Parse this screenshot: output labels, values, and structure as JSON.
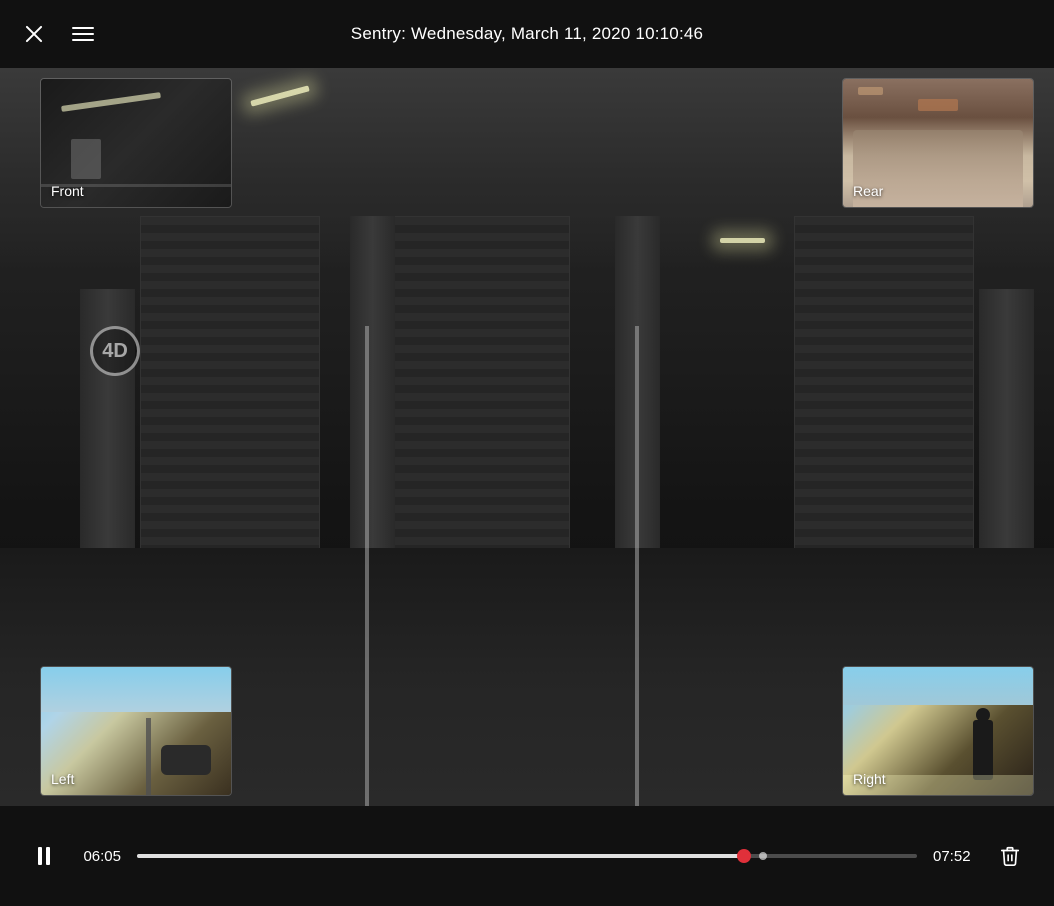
{
  "header": {
    "title": "Sentry: Wednesday, March 11, 2020 10:10:46",
    "close_label": "Close",
    "menu_label": "Menu"
  },
  "thumbnails": {
    "front": {
      "label": "Front"
    },
    "rear": {
      "label": "Rear"
    },
    "left": {
      "label": "Left"
    },
    "right": {
      "label": "Right"
    }
  },
  "controls": {
    "play_pause_label": "Pause",
    "current_time": "06:05",
    "total_time": "07:52",
    "progress_percent": 77.7,
    "delete_label": "Delete"
  },
  "icons": {
    "close": "✕",
    "menu": "≡",
    "pause": "⏸",
    "trash": "🗑"
  }
}
